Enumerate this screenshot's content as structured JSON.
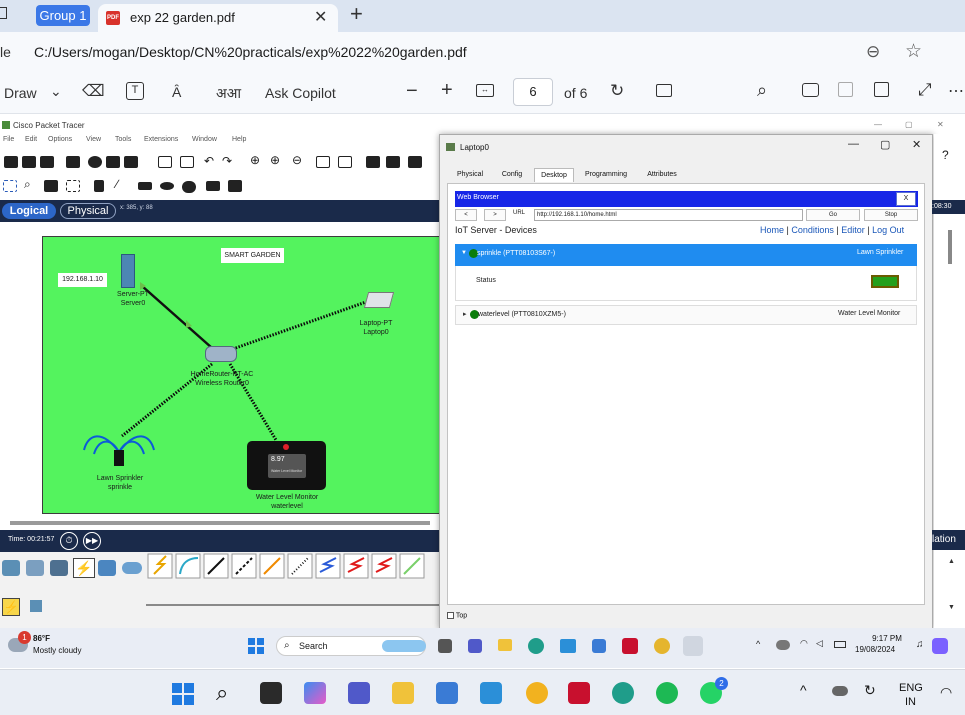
{
  "browser": {
    "group_label": "Group 1",
    "tab_title": "exp 22 garden.pdf",
    "address_prefix": "le",
    "address_url": "C:/Users/mogan/Desktop/CN%20practicals/exp%2022%20garden.pdf"
  },
  "pdf_toolbar": {
    "draw_label": "Draw",
    "read_aloud_label": "Ȃ",
    "translate_label": "अआ",
    "copilot_label": "Ask Copilot",
    "page_current": "6",
    "page_total": "of 6"
  },
  "packet_tracer": {
    "window_title": "Cisco Packet Tracer",
    "menu": [
      "File",
      "Edit",
      "Options",
      "View",
      "Tools",
      "Extensions",
      "Window",
      "Help"
    ],
    "logical_label": "Logical",
    "physical_label": "Physical",
    "coords": "x: 385, y: 88",
    "time_label": "Time: 00:21:57",
    "topology": {
      "title": "SMART GARDEN",
      "ip_label": "192.168.1.10",
      "server_label": "Server-PT",
      "server_name": "Server0",
      "laptop_label": "Laptop-PT",
      "laptop_name": "Laptop0",
      "router_label": "HomeRouter-PT-AC",
      "router_name": "Wireless Router0",
      "sprinkler_label": "Lawn Sprinkler",
      "sprinkler_name": "sprinkle",
      "wlm_label": "Water Level Monitor",
      "wlm_name": "waterlevel",
      "wlm_value": "8.97",
      "wlm_screen_label": "Water Level Monitor"
    },
    "right_time": ":08:30",
    "right_sim": "lation"
  },
  "laptop_dialog": {
    "title": "Laptop0",
    "tabs": [
      "Physical",
      "Config",
      "Desktop",
      "Programming",
      "Attributes"
    ],
    "active_tab": "Desktop",
    "web_browser": {
      "title": "Web Browser",
      "close": "X",
      "back": "<",
      "forward": ">",
      "url_label": "URL",
      "url": "http://192.168.1.10/home.html",
      "go": "Go",
      "stop": "Stop"
    },
    "iot": {
      "title": "IoT Server - Devices",
      "links": [
        "Home",
        "Conditions",
        "Editor",
        "Log Out"
      ],
      "devices": [
        {
          "name": "sprinkle (PTT08103S67-)",
          "type": "Lawn Sprinkler",
          "status_label": "Status",
          "expanded": true
        },
        {
          "name": "waterlevel (PTT0810XZM5-)",
          "type": "Water Level Monitor",
          "expanded": false
        }
      ]
    },
    "top_checkbox": "Top"
  },
  "inner_taskbar": {
    "weather_badge": "1",
    "temperature": "86°F",
    "weather": "Mostly cloudy",
    "search_placeholder": "Search",
    "time": "9:17 PM",
    "date": "19/08/2024"
  },
  "taskbar": {
    "lang_line1": "ENG",
    "lang_line2": "IN",
    "whatsapp_badge": "2"
  },
  "colors": {
    "canvas_green": "#54f35e",
    "browser_bar": "#1726e7",
    "device_header": "#1f8cf0",
    "status_on": "#23a01c"
  }
}
